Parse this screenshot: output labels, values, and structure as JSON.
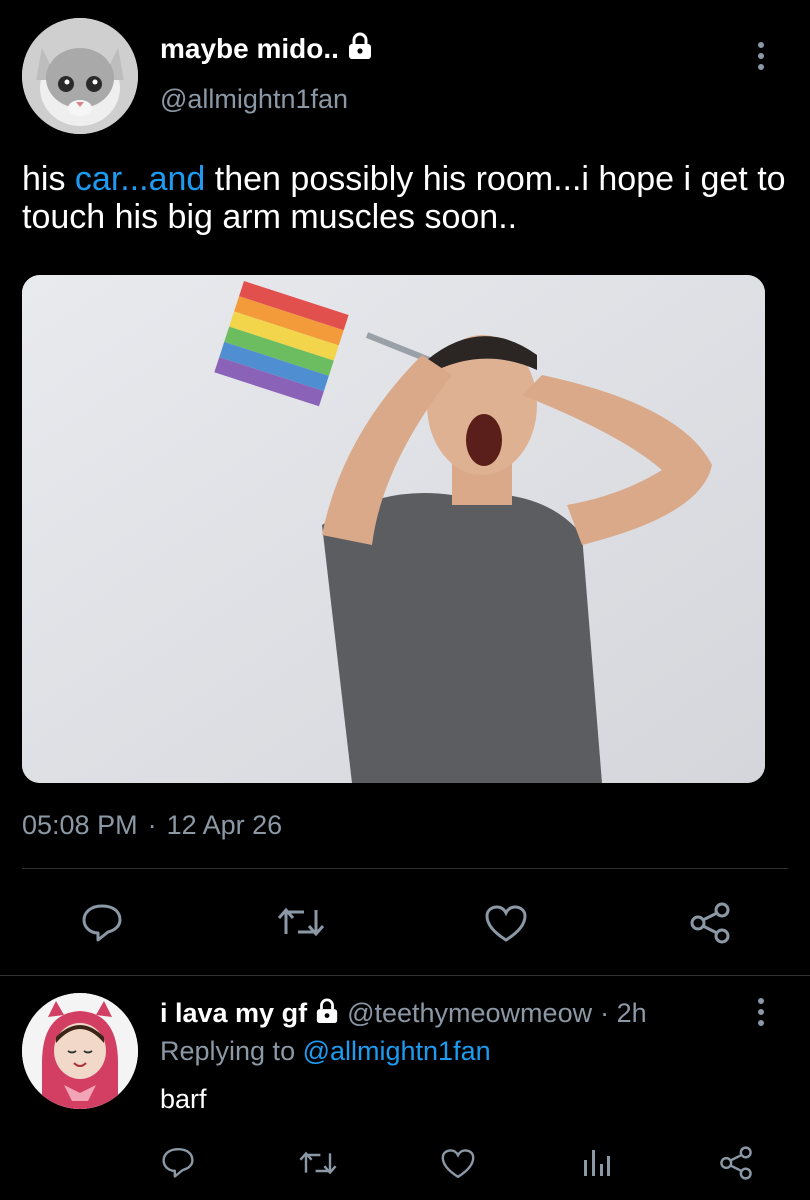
{
  "tweet": {
    "author_name": "maybe mido..",
    "author_handle": "@allmightn1fan",
    "text_prefix": "his ",
    "text_link": "car...and",
    "text_suffix": " then possibly his room...i hope i get to touch his big arm muscles soon..",
    "time": "05:08 PM",
    "separator": "·",
    "date": "12 Apr 26",
    "actions": [
      "reply-icon",
      "retweet-icon",
      "like-icon",
      "share-icon"
    ]
  },
  "reply": {
    "author_name": "i lava my gf",
    "author_handle": "@teethymeowmeow",
    "age": "· 2h",
    "replying_prefix": "Replying to ",
    "replying_handle": "@allmightn1fan",
    "text": "barf",
    "actions": [
      "reply-icon",
      "retweet-icon",
      "like-icon",
      "analytics-icon",
      "share-icon"
    ]
  },
  "colors": {
    "background": "#000000",
    "link": "#1d9bf0",
    "muted": "#8b98a5"
  }
}
